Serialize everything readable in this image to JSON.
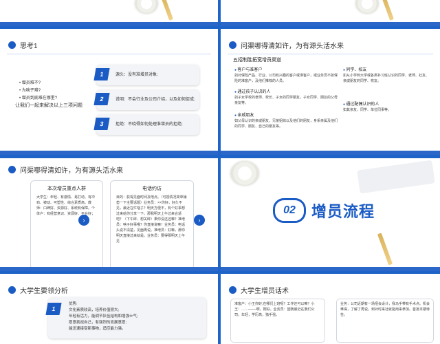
{
  "slide3": {
    "title": "思考1",
    "questions": [
      "增员难不?",
      "为啥子难?",
      "增员到底难在哪里?"
    ],
    "footer": "让我们一起来解决以上三项问题",
    "cards": [
      {
        "num": "1",
        "text": "源头：没有准增员对象;"
      },
      {
        "num": "2",
        "text": "说明：不会行业及公司介绍，以及如何促成;"
      },
      {
        "num": "3",
        "text": "拒绝：不晓得如何处理准增员的拒绝;"
      }
    ]
  },
  "slide4": {
    "title": "问渠哪得清如许，为有源头活水来",
    "subtitle": "五招制胜拓宽增员渠道",
    "channels": [
      {
        "t": "客户与准客户",
        "d": "如对保险产品、行业、公司有兴趣的客户或准客户，或业务员不如保险的准客户，及他们推荐的人员。"
      },
      {
        "t": "通过孩子认识的人",
        "d": "如子女学校的老师、校长、子女的同学朋友，子女同学、朋友的父母亲友等。"
      },
      {
        "t": "亲戚朋友",
        "d": "如父母认识的亲戚朋友、兄弟姐妹以及他们的朋友，身系亲属及他们的同学、朋友、自己的朋友等。"
      },
      {
        "t": "同学、校友",
        "d": "如从小学到大学或各类补习班认识的同学、老师、社友、亲戚朋友的同学、校友。"
      },
      {
        "t": "通过配偶认识的人",
        "d": "如其亲友、同学、单位同事等。"
      }
    ]
  },
  "slide5": {
    "title": "问渠哪得清如许，为有源头活水来",
    "left_title": "本次增员重点人群",
    "left_text": "大学生：年轻、有激情、易打动、有冲劲、被动、可塑性、综合素质高。教师：口碑好、资源好、系统有保障。个体户：有经营意识、资源好、平台好；",
    "right_title": "电话约访",
    "right_text": "目的：获得见面时间及地点。（可视情况简单铺垫一下主要话题）业务员：××你好，好久不见，最近在忙啥子？明天方便不，有个好事想过来给你分享一下。那我明天上午过来合适吧？（下午碎、想关碎）果你没还还嘛？准增员：啥子好事哦？你直接说嘛！业务员：电话头说不清楚，见面再说。准增员：好嘛，那你明天直接过来就是。业务员：要得那明天上午见"
  },
  "slide6": {
    "badge": "02",
    "heading": "增员流程"
  },
  "slide7": {
    "title": "大学生要领分析",
    "num": "1",
    "lines": [
      "优势:",
      "文化素质较高，培养价值很大;",
      "年轻有活力，能调节队伍结构和增强士气;",
      "愿意挑战自己，有强烈的发展意愿;",
      "能迅速接受新事物，适应能力强。"
    ]
  },
  "slide8": {
    "title": "大学生增员话术",
    "left": "准客户：小王你好,在哪们上班呢？工作还可以嘛？小王：……——-啊，刚好。业务员：因我最近在我们公司，年轻，学历高，独手强。",
    "right": "业务：公司近期有一场招会设计，我马手带有手术点。机会难得，了解了再说，到对时来社就能用来参加。首批本期待告。"
  }
}
